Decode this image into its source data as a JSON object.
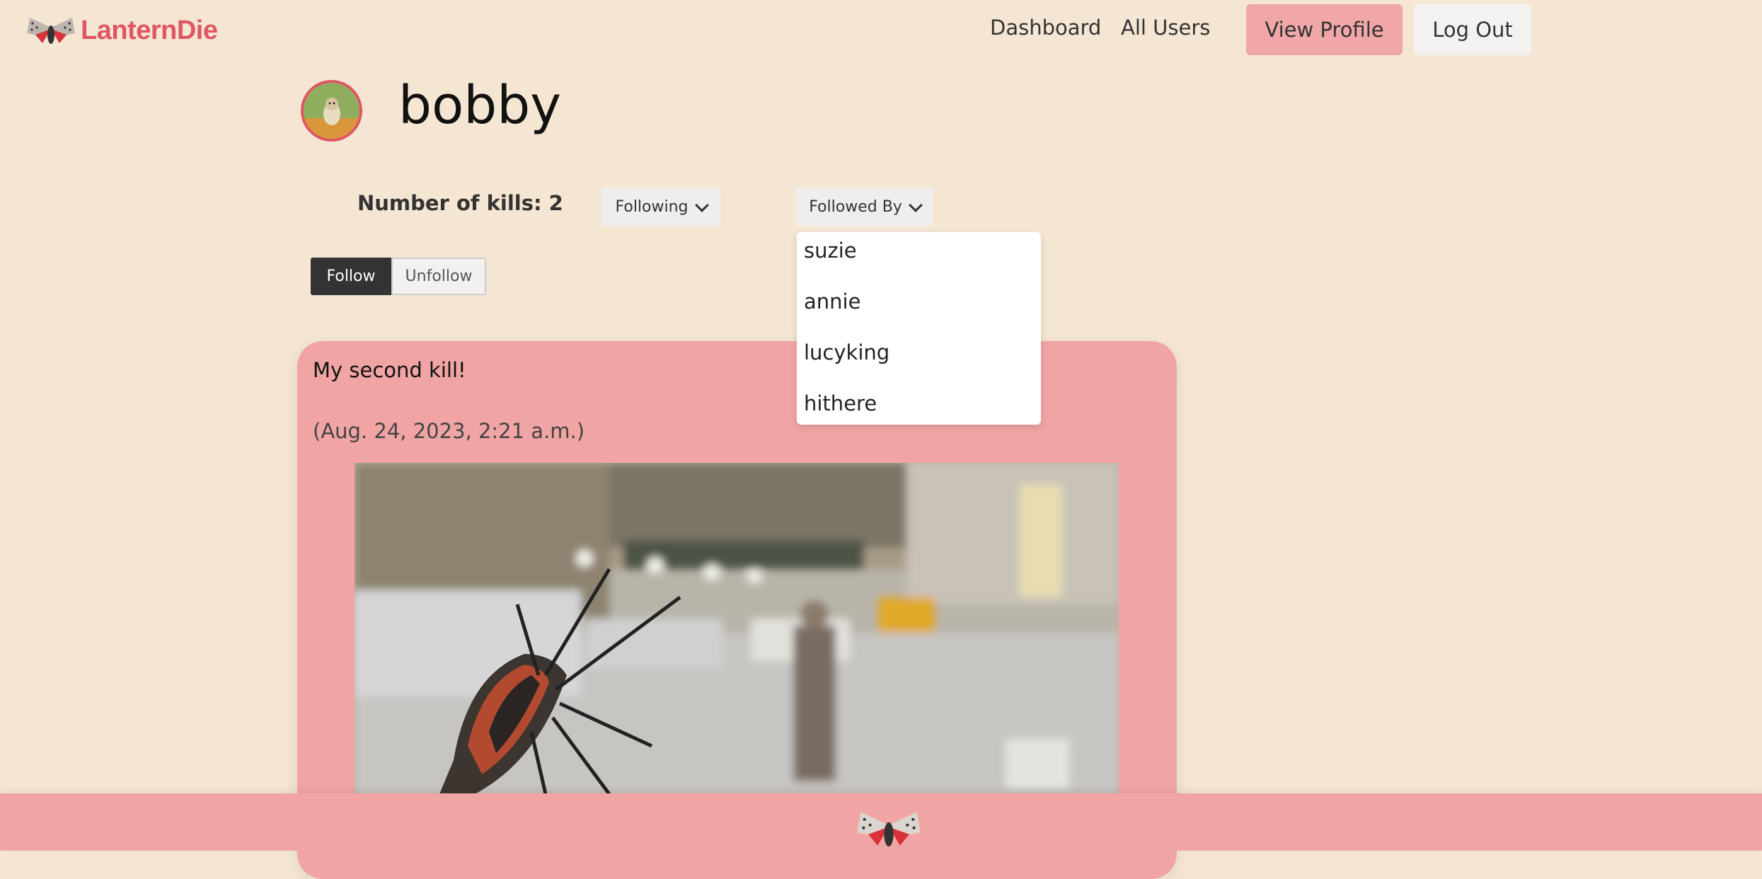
{
  "nav": {
    "brand": "LanternDie",
    "links": [
      "Dashboard",
      "All Users"
    ],
    "view_profile": "View Profile",
    "log_out": "Log Out"
  },
  "profile": {
    "username": "bobby",
    "kills_label": "Number of kills: 2",
    "following_label": "Following",
    "followed_by_label": "Followed By",
    "follow_label": "Follow",
    "unfollow_label": "Unfollow"
  },
  "followed_by_menu": {
    "items": [
      "suzie",
      "annie",
      "lucyking",
      "hithere"
    ]
  },
  "post": {
    "title": "My second kill!",
    "date": "(Aug. 24, 2023, 2:21 a.m.)"
  },
  "colors": {
    "background": "#f4e6d3",
    "accent_pink": "#f1a4a4",
    "brand_red": "#e05563",
    "dark_button": "#333333"
  },
  "icons": {
    "brand": "lanternfly-logo-icon",
    "dropdown": "chevron-down-icon",
    "footer": "lanternfly-footer-icon"
  }
}
